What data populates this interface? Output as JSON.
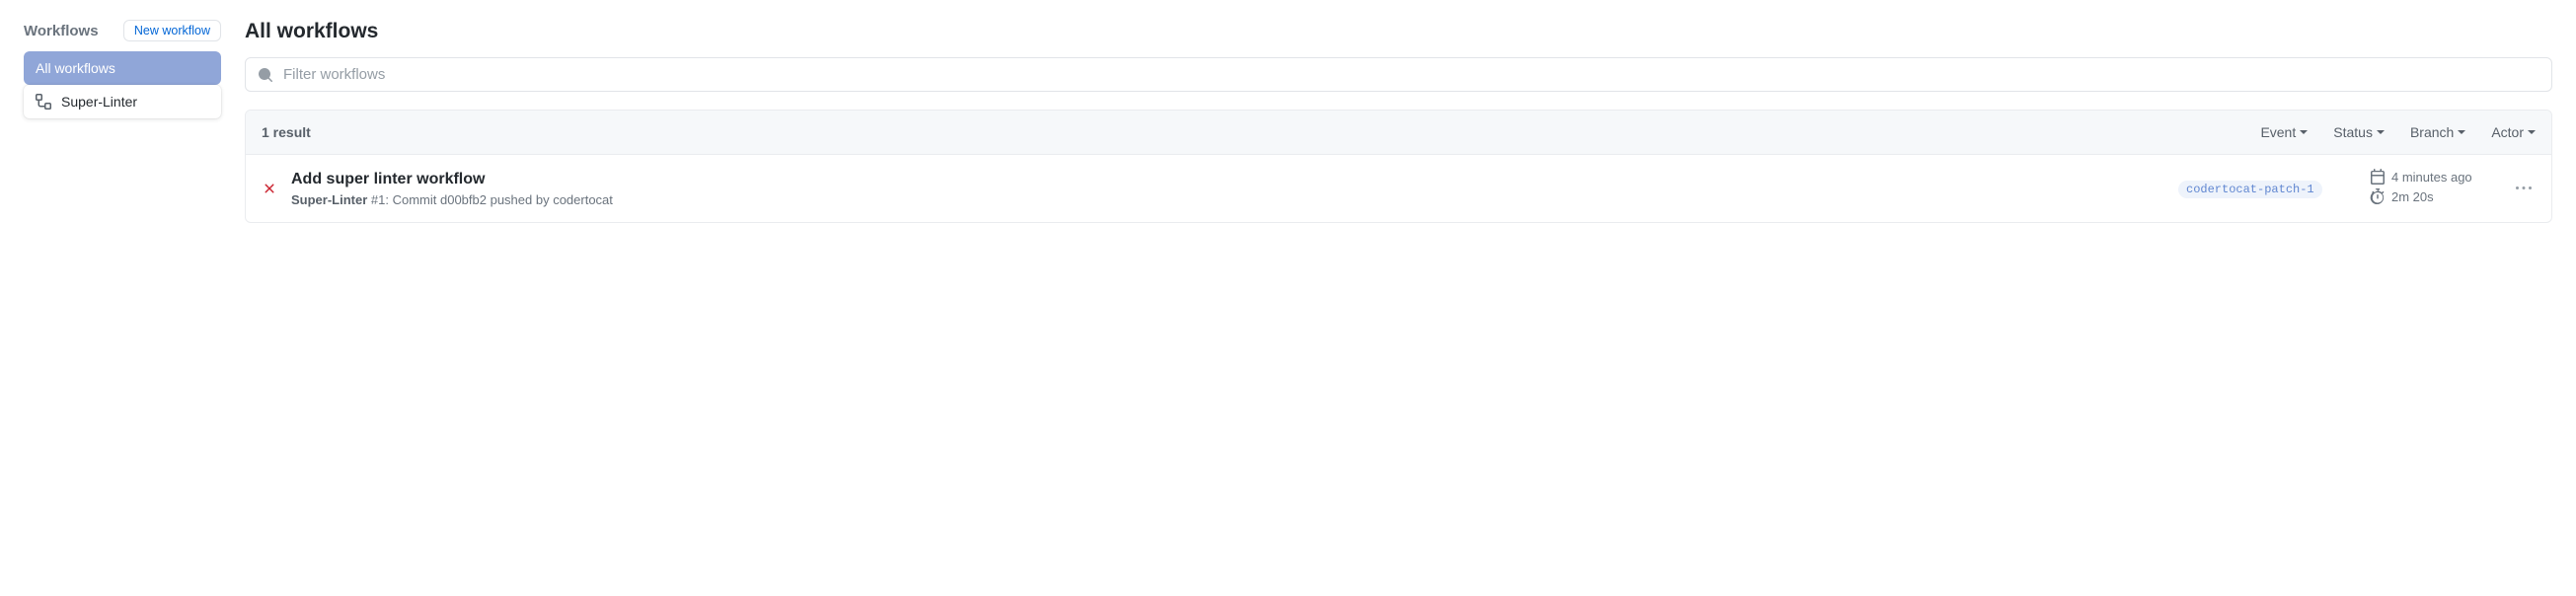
{
  "sidebar": {
    "title": "Workflows",
    "new_btn": "New workflow",
    "items": [
      {
        "label": "All workflows"
      },
      {
        "label": "Super-Linter"
      }
    ]
  },
  "main": {
    "title": "All workflows",
    "filter_placeholder": "Filter workflows"
  },
  "results": {
    "count_label": "1 result",
    "filters": {
      "event": "Event",
      "status": "Status",
      "branch": "Branch",
      "actor": "Actor"
    }
  },
  "run": {
    "title": "Add super linter workflow",
    "workflow_name": "Super-Linter",
    "run_detail": " #1: Commit d00bfb2 pushed by codertocat",
    "branch": "codertocat-patch-1",
    "time_ago": "4 minutes ago",
    "duration": "2m 20s"
  }
}
